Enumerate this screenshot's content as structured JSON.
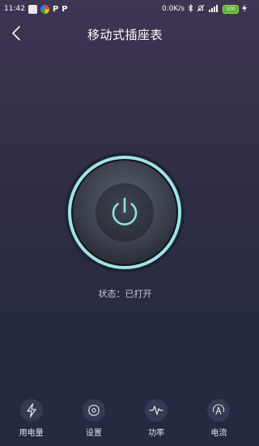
{
  "status_bar": {
    "time": "11:42",
    "network_speed": "0.0K/s",
    "battery": "100",
    "icons": [
      "app-icon-grey",
      "app-icon-colorful",
      "p-icon",
      "p-icon",
      "bluetooth-icon",
      "alarm-off-icon",
      "signal-icon",
      "charging-icon"
    ]
  },
  "header": {
    "title": "移动式插座表",
    "back_icon": "chevron-left-icon"
  },
  "power": {
    "icon": "power-icon",
    "state_text": "状态：已打开",
    "ring_color": "#9fe3e8"
  },
  "nav": {
    "items": [
      {
        "label": "用电量",
        "icon": "lightning-icon"
      },
      {
        "label": "设置",
        "icon": "gear-icon"
      },
      {
        "label": "功率",
        "icon": "pulse-icon"
      },
      {
        "label": "电流",
        "icon": "current-a-icon"
      }
    ]
  }
}
